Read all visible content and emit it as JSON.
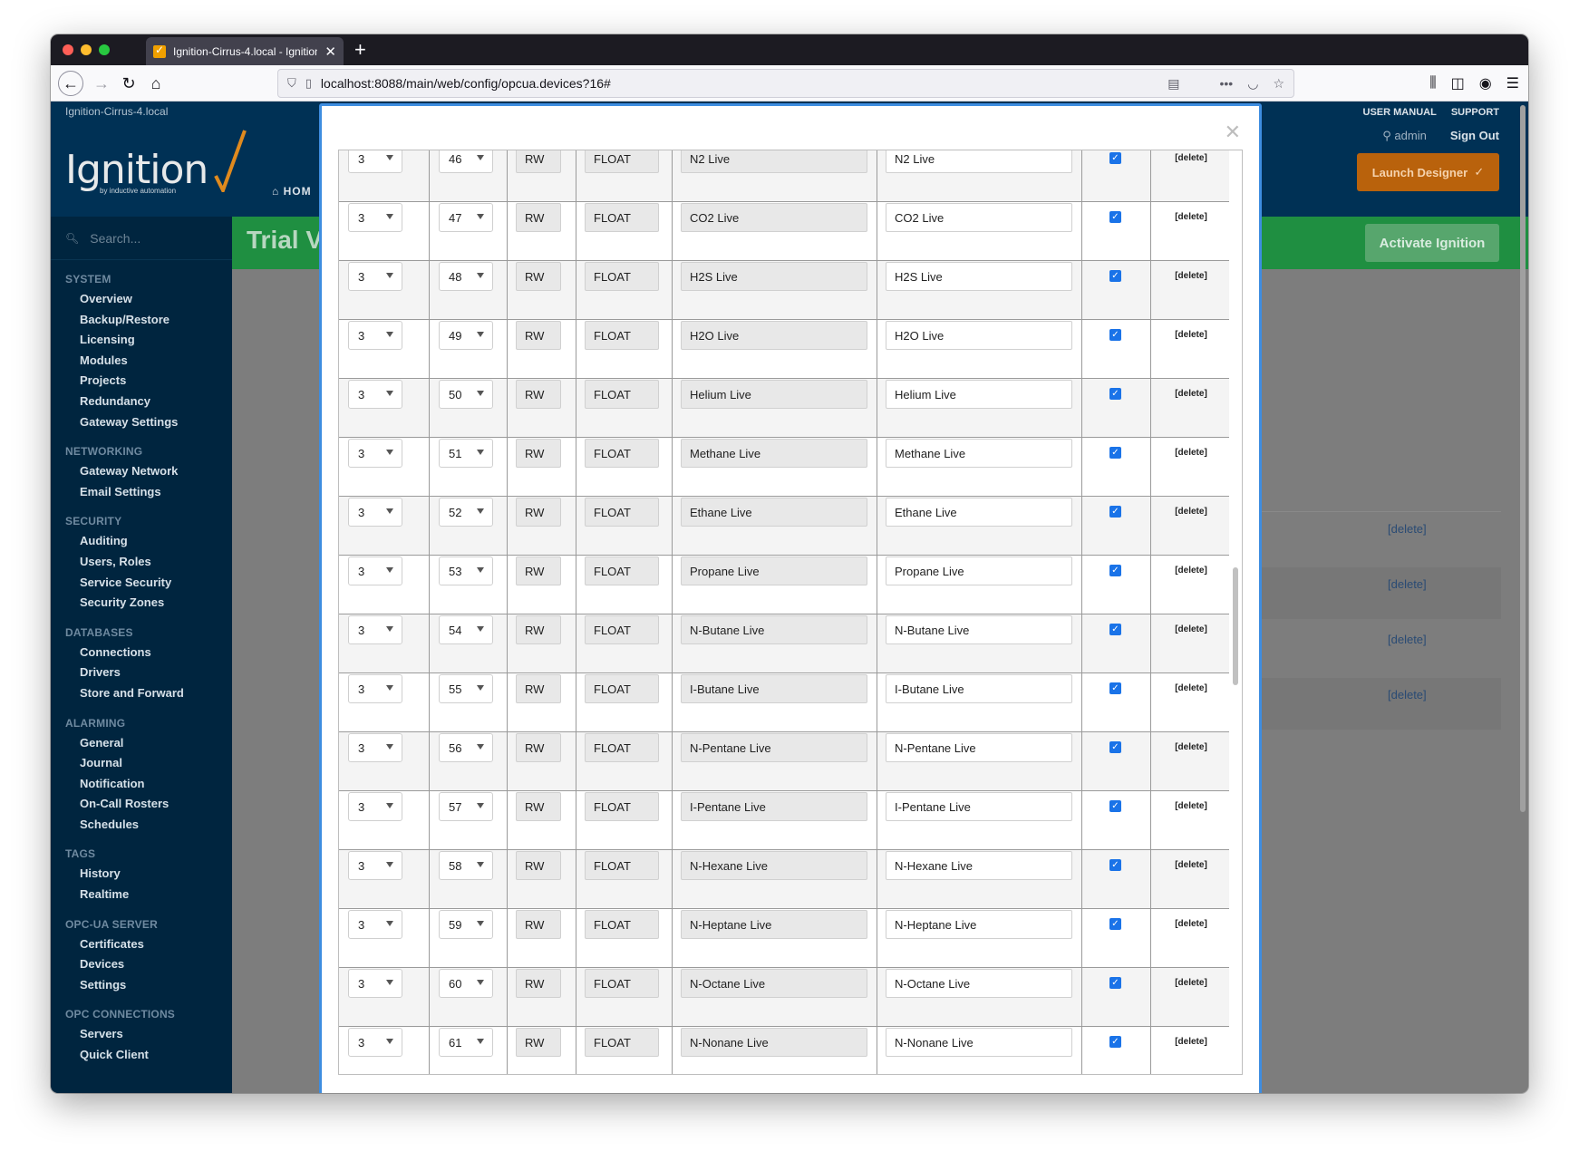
{
  "browser": {
    "tab_title": "Ignition-Cirrus-4.local - Ignition",
    "new_tab_symbol": "+",
    "url_host": "localhost",
    "url_rest": ":8088/main/web/config/opcua.devices?16#"
  },
  "header": {
    "host_label": "Ignition-Cirrus-4.local",
    "logo_text": "Ignition",
    "logo_sub": "by inductive automation",
    "home_label": "HOM",
    "user_manual": "USER MANUAL",
    "support": "SUPPORT",
    "user": "admin",
    "sign_out": "Sign Out",
    "launch_designer": "Launch Designer"
  },
  "banner": {
    "trial_text": "Trial V",
    "activate_label": "Activate Ignition"
  },
  "sidebar": {
    "search_placeholder": "Search...",
    "sections": [
      {
        "heading": "SYSTEM",
        "items": [
          "Overview",
          "Backup/Restore",
          "Licensing",
          "Modules",
          "Projects",
          "Redundancy",
          "Gateway Settings"
        ]
      },
      {
        "heading": "NETWORKING",
        "items": [
          "Gateway Network",
          "Email Settings"
        ]
      },
      {
        "heading": "SECURITY",
        "items": [
          "Auditing",
          "Users, Roles",
          "Service Security",
          "Security Zones"
        ]
      },
      {
        "heading": "DATABASES",
        "items": [
          "Connections",
          "Drivers",
          "Store and Forward"
        ]
      },
      {
        "heading": "ALARMING",
        "items": [
          "General",
          "Journal",
          "Notification",
          "On-Call Rosters",
          "Schedules"
        ]
      },
      {
        "heading": "TAGS",
        "items": [
          "History",
          "Realtime"
        ]
      },
      {
        "heading": "OPC-UA SERVER",
        "items": [
          "Certificates",
          "Devices",
          "Settings"
        ]
      },
      {
        "heading": "OPC CONNECTIONS",
        "items": [
          "Servers",
          "Quick Client"
        ]
      }
    ]
  },
  "background": {
    "delete_label": "[delete]"
  },
  "modal": {
    "close_symbol": "✕",
    "delete_label": "[delete]",
    "rows": [
      {
        "ns": "3",
        "reg": "46",
        "access": "RW",
        "type": "FLOAT",
        "name": "N2 Live",
        "desc": "N2 Live",
        "checked": true
      },
      {
        "ns": "3",
        "reg": "47",
        "access": "RW",
        "type": "FLOAT",
        "name": "CO2 Live",
        "desc": "CO2 Live",
        "checked": true
      },
      {
        "ns": "3",
        "reg": "48",
        "access": "RW",
        "type": "FLOAT",
        "name": "H2S Live",
        "desc": "H2S Live",
        "checked": true
      },
      {
        "ns": "3",
        "reg": "49",
        "access": "RW",
        "type": "FLOAT",
        "name": "H2O Live",
        "desc": "H2O Live",
        "checked": true
      },
      {
        "ns": "3",
        "reg": "50",
        "access": "RW",
        "type": "FLOAT",
        "name": "Helium Live",
        "desc": "Helium Live",
        "checked": true
      },
      {
        "ns": "3",
        "reg": "51",
        "access": "RW",
        "type": "FLOAT",
        "name": "Methane Live",
        "desc": "Methane Live",
        "checked": true
      },
      {
        "ns": "3",
        "reg": "52",
        "access": "RW",
        "type": "FLOAT",
        "name": "Ethane Live",
        "desc": "Ethane Live",
        "checked": true
      },
      {
        "ns": "3",
        "reg": "53",
        "access": "RW",
        "type": "FLOAT",
        "name": "Propane Live",
        "desc": "Propane Live",
        "checked": true
      },
      {
        "ns": "3",
        "reg": "54",
        "access": "RW",
        "type": "FLOAT",
        "name": "N-Butane Live",
        "desc": "N-Butane Live",
        "checked": true
      },
      {
        "ns": "3",
        "reg": "55",
        "access": "RW",
        "type": "FLOAT",
        "name": "I-Butane Live",
        "desc": "I-Butane Live",
        "checked": true
      },
      {
        "ns": "3",
        "reg": "56",
        "access": "RW",
        "type": "FLOAT",
        "name": "N-Pentane Live",
        "desc": "N-Pentane Live",
        "checked": true
      },
      {
        "ns": "3",
        "reg": "57",
        "access": "RW",
        "type": "FLOAT",
        "name": "I-Pentane Live",
        "desc": "I-Pentane Live",
        "checked": true
      },
      {
        "ns": "3",
        "reg": "58",
        "access": "RW",
        "type": "FLOAT",
        "name": "N-Hexane Live",
        "desc": "N-Hexane Live",
        "checked": true
      },
      {
        "ns": "3",
        "reg": "59",
        "access": "RW",
        "type": "FLOAT",
        "name": "N-Heptane Live",
        "desc": "N-Heptane Live",
        "checked": true
      },
      {
        "ns": "3",
        "reg": "60",
        "access": "RW",
        "type": "FLOAT",
        "name": "N-Octane Live",
        "desc": "N-Octane Live",
        "checked": true
      },
      {
        "ns": "3",
        "reg": "61",
        "access": "RW",
        "type": "FLOAT",
        "name": "N-Nonane Live",
        "desc": "N-Nonane Live",
        "checked": true
      }
    ]
  }
}
